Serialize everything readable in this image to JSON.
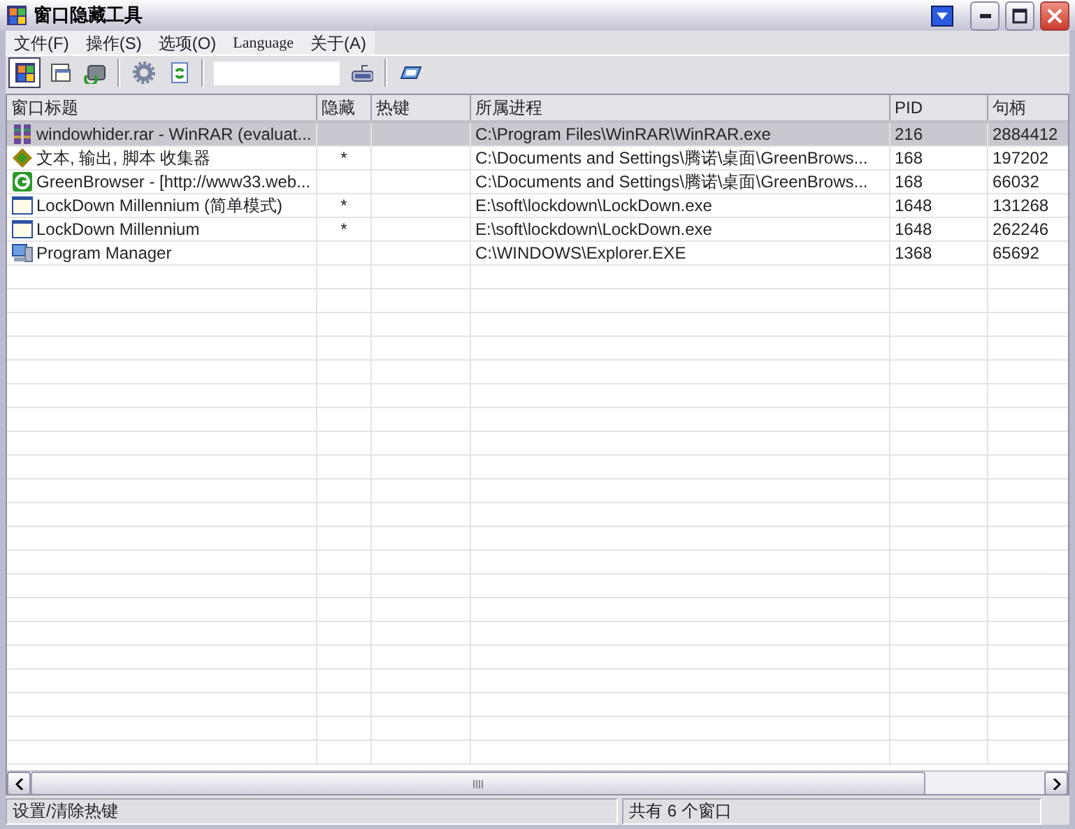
{
  "window": {
    "title": "窗口隐藏工具"
  },
  "menu": [
    {
      "label": "文件(F)"
    },
    {
      "label": "操作(S)"
    },
    {
      "label": "选项(O)"
    },
    {
      "label": "Language"
    },
    {
      "label": "关于(A)"
    }
  ],
  "toolbar": [
    {
      "kind": "windows",
      "pressed": true
    },
    {
      "kind": "window",
      "pressed": false
    },
    {
      "kind": "drive",
      "pressed": false
    },
    {
      "kind": "separator"
    },
    {
      "kind": "gear",
      "pressed": false
    },
    {
      "kind": "refresh",
      "pressed": false
    },
    {
      "kind": "separator"
    },
    {
      "kind": "field"
    },
    {
      "kind": "keyboard",
      "pressed": false
    },
    {
      "kind": "separator"
    },
    {
      "kind": "card",
      "pressed": false
    }
  ],
  "table": {
    "columns": [
      "窗口标题",
      "隐藏",
      "热键",
      "所属进程",
      "PID",
      "句柄"
    ],
    "rows": [
      {
        "kind": "archive",
        "selected": true,
        "title": "windowhider.rar - WinRAR (evaluat...",
        "process": "C:\\Program Files\\WinRAR\\WinRAR.exe",
        "pid": "216",
        "handle": "2884412"
      },
      {
        "kind": "gem",
        "selected": false,
        "title": "文本, 输出, 脚本 收集器",
        "hidden": "*",
        "process": "C:\\Documents and Settings\\腾诺\\桌面\\GreenBrows...",
        "pid": "168",
        "handle": "197202"
      },
      {
        "kind": "browser",
        "selected": false,
        "title": "GreenBrowser - [http://www33.web...",
        "process": "C:\\Documents and Settings\\腾诺\\桌面\\GreenBrows...",
        "pid": "168",
        "handle": "66032"
      },
      {
        "kind": "window",
        "selected": false,
        "title": "LockDown Millennium (简单模式)",
        "hidden": "*",
        "process": "E:\\soft\\lockdown\\LockDown.exe",
        "pid": "1648",
        "handle": "131268"
      },
      {
        "kind": "window",
        "selected": false,
        "title": "LockDown Millennium",
        "hidden": "*",
        "process": "E:\\soft\\lockdown\\LockDown.exe",
        "pid": "1648",
        "handle": "262246"
      },
      {
        "kind": "computer",
        "selected": false,
        "title": "Program Manager",
        "process": "C:\\WINDOWS\\Explorer.EXE",
        "pid": "1368",
        "handle": "65692"
      }
    ]
  },
  "status_bar": [
    "设置/清除热键",
    "共有 6 个窗口"
  ]
}
